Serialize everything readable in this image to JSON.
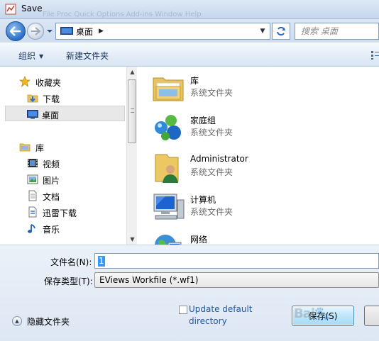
{
  "window": {
    "title": "Save",
    "ghost_menu": "File   Proc   Quick   Options   Add-ins   Window   Help"
  },
  "nav": {
    "breadcrumb": "桌面",
    "search_placeholder": "搜索 桌面"
  },
  "toolbar": {
    "organize_label": "组织",
    "new_folder_label": "新建文件夹"
  },
  "sidebar": {
    "favorites": [
      {
        "label": "收藏夹",
        "icon": "star-icon"
      },
      {
        "label": "下载",
        "icon": "download-folder-icon"
      },
      {
        "label": "桌面",
        "icon": "desktop-icon",
        "selected": true
      }
    ],
    "libraries": [
      {
        "label": "库",
        "icon": "library-icon"
      },
      {
        "label": "视频",
        "icon": "video-icon"
      },
      {
        "label": "图片",
        "icon": "picture-icon"
      },
      {
        "label": "文档",
        "icon": "document-icon"
      },
      {
        "label": "迅雷下载",
        "icon": "thunder-download-icon"
      },
      {
        "label": "音乐",
        "icon": "music-icon"
      }
    ]
  },
  "files": [
    {
      "name": "库",
      "type": "系统文件夹",
      "icon": "library-folder-icon"
    },
    {
      "name": "家庭组",
      "type": "系统文件夹",
      "icon": "homegroup-icon"
    },
    {
      "name": "Administrator",
      "type": "系统文件夹",
      "icon": "user-folder-icon"
    },
    {
      "name": "计算机",
      "type": "系统文件夹",
      "icon": "computer-icon"
    },
    {
      "name": "网络",
      "type": "",
      "icon": "network-icon"
    }
  ],
  "form": {
    "filename_label": "文件名(N):",
    "filename_value": "1",
    "filetype_label": "保存类型(T):",
    "filetype_value": "EViews Workfile (*.wf1)",
    "update_default_label": "Update default directory",
    "hide_folders_label": "隐藏文件夹",
    "save_button_label": "保存(S)",
    "cancel_button_label": ""
  },
  "colors": {
    "accent_blue": "#3399ff",
    "link_blue": "#1d5aa8",
    "title_gradient_top": "#dfe9f5"
  }
}
